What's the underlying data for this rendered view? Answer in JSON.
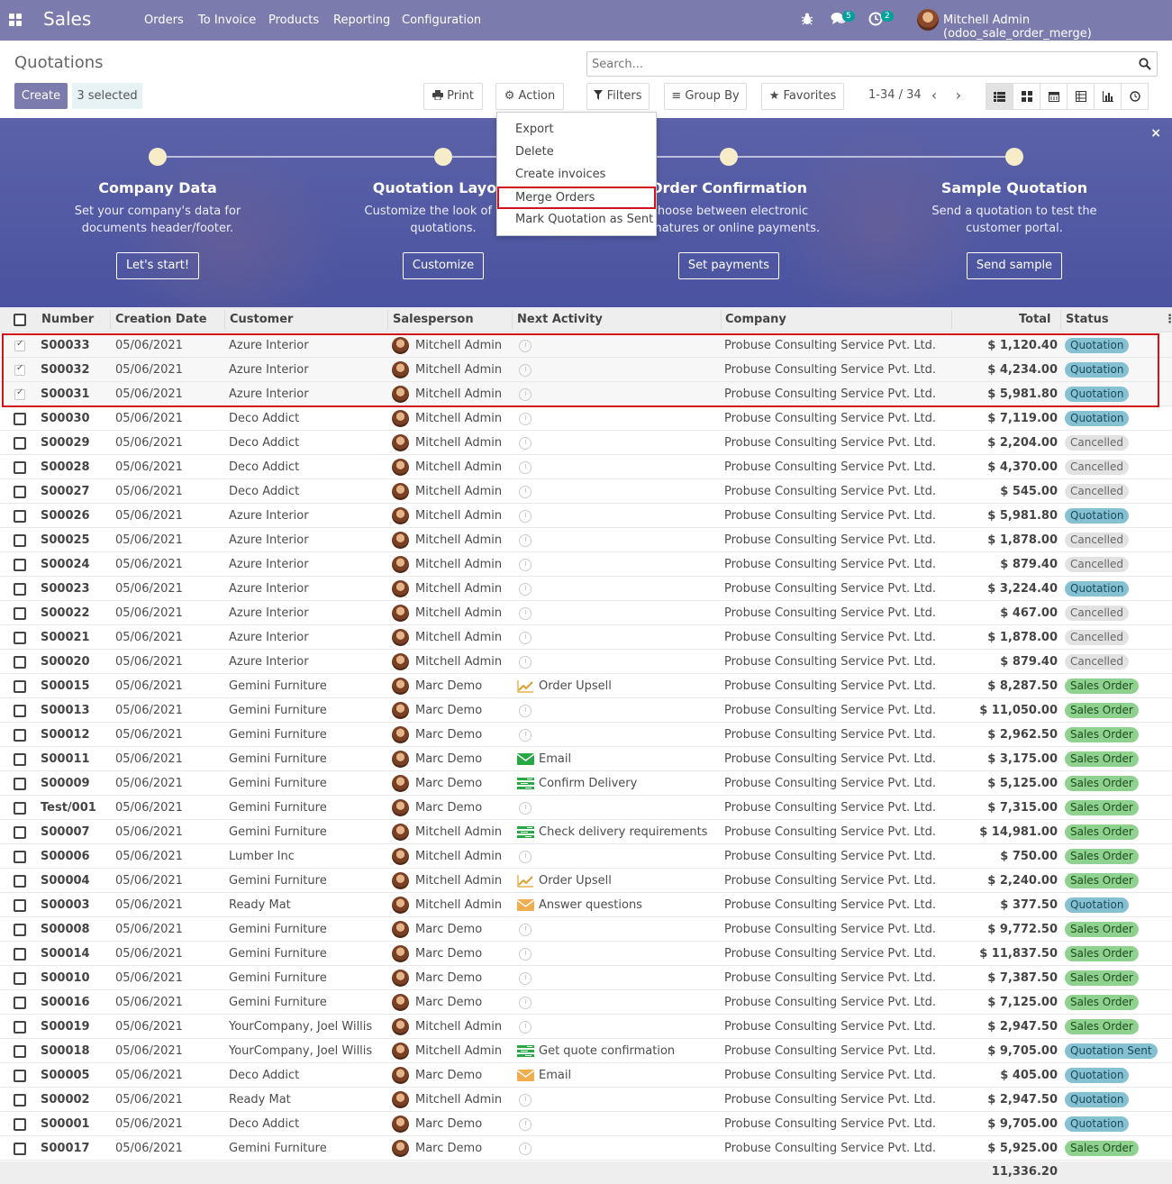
{
  "navbar": {
    "app_title": "Sales",
    "menu": [
      "Orders",
      "To Invoice",
      "Products",
      "Reporting",
      "Configuration"
    ],
    "messages_count": "5",
    "activities_count": "2",
    "user": "Mitchell Admin (odoo_sale_order_merge)"
  },
  "control": {
    "breadcrumb": "Quotations",
    "create": "Create",
    "selected": "3 selected",
    "print": "Print",
    "action": "Action",
    "search_placeholder": "Search...",
    "filters": "Filters",
    "group_by": "Group By",
    "favorites": "Favorites",
    "pager": "1-34 / 34"
  },
  "action_menu": [
    "Export",
    "Delete",
    "Create invoices",
    "Merge Orders",
    "Mark Quotation as Sent"
  ],
  "banner": {
    "steps": [
      {
        "title": "Company Data",
        "desc1": "Set your company's data for",
        "desc2": "documents header/footer.",
        "button": "Let's start!"
      },
      {
        "title": "Quotation Layout",
        "desc1": "Customize the look of your",
        "desc2": "quotations.",
        "button": "Customize"
      },
      {
        "title": "Order Confirmation",
        "desc1": "Choose between electronic",
        "desc2": "signatures or online payments.",
        "button": "Set payments"
      },
      {
        "title": "Sample Quotation",
        "desc1": "Send a quotation to test the",
        "desc2": "customer portal.",
        "button": "Send sample"
      }
    ],
    "close": "×"
  },
  "columns": [
    "Number",
    "Creation Date",
    "Customer",
    "Salesperson",
    "Next Activity",
    "Company",
    "Total",
    "Status"
  ],
  "rows": [
    {
      "num": "S00033",
      "date": "05/06/2021",
      "cust": "Azure Interior",
      "sp": "Mitchell Admin",
      "act": "",
      "actIcon": "",
      "comp": "Probuse Consulting Service Pvt. Ltd.",
      "total": "$ 1,120.40",
      "status": "Quotation",
      "st": "q",
      "sel": true
    },
    {
      "num": "S00032",
      "date": "05/06/2021",
      "cust": "Azure Interior",
      "sp": "Mitchell Admin",
      "act": "",
      "actIcon": "",
      "comp": "Probuse Consulting Service Pvt. Ltd.",
      "total": "$ 4,234.00",
      "status": "Quotation",
      "st": "q",
      "sel": true
    },
    {
      "num": "S00031",
      "date": "05/06/2021",
      "cust": "Azure Interior",
      "sp": "Mitchell Admin",
      "act": "",
      "actIcon": "",
      "comp": "Probuse Consulting Service Pvt. Ltd.",
      "total": "$ 5,981.80",
      "status": "Quotation",
      "st": "q",
      "sel": true
    },
    {
      "num": "S00030",
      "date": "05/06/2021",
      "cust": "Deco Addict",
      "sp": "Mitchell Admin",
      "act": "",
      "actIcon": "",
      "comp": "Probuse Consulting Service Pvt. Ltd.",
      "total": "$ 7,119.00",
      "status": "Quotation",
      "st": "q",
      "sel": false
    },
    {
      "num": "S00029",
      "date": "05/06/2021",
      "cust": "Deco Addict",
      "sp": "Mitchell Admin",
      "act": "",
      "actIcon": "",
      "comp": "Probuse Consulting Service Pvt. Ltd.",
      "total": "$ 2,204.00",
      "status": "Cancelled",
      "st": "c",
      "sel": false
    },
    {
      "num": "S00028",
      "date": "05/06/2021",
      "cust": "Deco Addict",
      "sp": "Mitchell Admin",
      "act": "",
      "actIcon": "",
      "comp": "Probuse Consulting Service Pvt. Ltd.",
      "total": "$ 4,370.00",
      "status": "Cancelled",
      "st": "c",
      "sel": false
    },
    {
      "num": "S00027",
      "date": "05/06/2021",
      "cust": "Deco Addict",
      "sp": "Mitchell Admin",
      "act": "",
      "actIcon": "",
      "comp": "Probuse Consulting Service Pvt. Ltd.",
      "total": "$ 545.00",
      "status": "Cancelled",
      "st": "c",
      "sel": false
    },
    {
      "num": "S00026",
      "date": "05/06/2021",
      "cust": "Azure Interior",
      "sp": "Mitchell Admin",
      "act": "",
      "actIcon": "",
      "comp": "Probuse Consulting Service Pvt. Ltd.",
      "total": "$ 5,981.80",
      "status": "Quotation",
      "st": "q",
      "sel": false
    },
    {
      "num": "S00025",
      "date": "05/06/2021",
      "cust": "Azure Interior",
      "sp": "Mitchell Admin",
      "act": "",
      "actIcon": "",
      "comp": "Probuse Consulting Service Pvt. Ltd.",
      "total": "$ 1,878.00",
      "status": "Cancelled",
      "st": "c",
      "sel": false
    },
    {
      "num": "S00024",
      "date": "05/06/2021",
      "cust": "Azure Interior",
      "sp": "Mitchell Admin",
      "act": "",
      "actIcon": "",
      "comp": "Probuse Consulting Service Pvt. Ltd.",
      "total": "$ 879.40",
      "status": "Cancelled",
      "st": "c",
      "sel": false
    },
    {
      "num": "S00023",
      "date": "05/06/2021",
      "cust": "Azure Interior",
      "sp": "Mitchell Admin",
      "act": "",
      "actIcon": "",
      "comp": "Probuse Consulting Service Pvt. Ltd.",
      "total": "$ 3,224.40",
      "status": "Quotation",
      "st": "q",
      "sel": false
    },
    {
      "num": "S00022",
      "date": "05/06/2021",
      "cust": "Azure Interior",
      "sp": "Mitchell Admin",
      "act": "",
      "actIcon": "",
      "comp": "Probuse Consulting Service Pvt. Ltd.",
      "total": "$ 467.00",
      "status": "Cancelled",
      "st": "c",
      "sel": false
    },
    {
      "num": "S00021",
      "date": "05/06/2021",
      "cust": "Azure Interior",
      "sp": "Mitchell Admin",
      "act": "",
      "actIcon": "",
      "comp": "Probuse Consulting Service Pvt. Ltd.",
      "total": "$ 1,878.00",
      "status": "Cancelled",
      "st": "c",
      "sel": false
    },
    {
      "num": "S00020",
      "date": "05/06/2021",
      "cust": "Azure Interior",
      "sp": "Mitchell Admin",
      "act": "",
      "actIcon": "",
      "comp": "Probuse Consulting Service Pvt. Ltd.",
      "total": "$ 879.40",
      "status": "Cancelled",
      "st": "c",
      "sel": false
    },
    {
      "num": "S00015",
      "date": "05/06/2021",
      "cust": "Gemini Furniture",
      "sp": "Marc Demo",
      "act": "Order Upsell",
      "actIcon": "upsell",
      "comp": "Probuse Consulting Service Pvt. Ltd.",
      "total": "$ 8,287.50",
      "status": "Sales Order",
      "st": "s",
      "sel": false
    },
    {
      "num": "S00013",
      "date": "05/06/2021",
      "cust": "Gemini Furniture",
      "sp": "Marc Demo",
      "act": "",
      "actIcon": "",
      "comp": "Probuse Consulting Service Pvt. Ltd.",
      "total": "$ 11,050.00",
      "status": "Sales Order",
      "st": "s",
      "sel": false
    },
    {
      "num": "S00012",
      "date": "05/06/2021",
      "cust": "Gemini Furniture",
      "sp": "Marc Demo",
      "act": "",
      "actIcon": "",
      "comp": "Probuse Consulting Service Pvt. Ltd.",
      "total": "$ 2,962.50",
      "status": "Sales Order",
      "st": "s",
      "sel": false
    },
    {
      "num": "S00011",
      "date": "05/06/2021",
      "cust": "Gemini Furniture",
      "sp": "Marc Demo",
      "act": "Email",
      "actIcon": "email-green",
      "comp": "Probuse Consulting Service Pvt. Ltd.",
      "total": "$ 3,175.00",
      "status": "Sales Order",
      "st": "s",
      "sel": false
    },
    {
      "num": "S00009",
      "date": "05/06/2021",
      "cust": "Gemini Furniture",
      "sp": "Marc Demo",
      "act": "Confirm Delivery",
      "actIcon": "tasks",
      "comp": "Probuse Consulting Service Pvt. Ltd.",
      "total": "$ 5,125.00",
      "status": "Sales Order",
      "st": "s",
      "sel": false
    },
    {
      "num": "Test/001",
      "date": "05/06/2021",
      "cust": "Gemini Furniture",
      "sp": "Marc Demo",
      "act": "",
      "actIcon": "",
      "comp": "Probuse Consulting Service Pvt. Ltd.",
      "total": "$ 7,315.00",
      "status": "Sales Order",
      "st": "s",
      "sel": false
    },
    {
      "num": "S00007",
      "date": "05/06/2021",
      "cust": "Gemini Furniture",
      "sp": "Mitchell Admin",
      "act": "Check delivery requirements",
      "actIcon": "tasks",
      "comp": "Probuse Consulting Service Pvt. Ltd.",
      "total": "$ 14,981.00",
      "status": "Sales Order",
      "st": "s",
      "sel": false
    },
    {
      "num": "S00006",
      "date": "05/06/2021",
      "cust": "Lumber Inc",
      "sp": "Mitchell Admin",
      "act": "",
      "actIcon": "",
      "comp": "Probuse Consulting Service Pvt. Ltd.",
      "total": "$ 750.00",
      "status": "Sales Order",
      "st": "s",
      "sel": false
    },
    {
      "num": "S00004",
      "date": "05/06/2021",
      "cust": "Gemini Furniture",
      "sp": "Mitchell Admin",
      "act": "Order Upsell",
      "actIcon": "upsell",
      "comp": "Probuse Consulting Service Pvt. Ltd.",
      "total": "$ 2,240.00",
      "status": "Sales Order",
      "st": "s",
      "sel": false
    },
    {
      "num": "S00003",
      "date": "05/06/2021",
      "cust": "Ready Mat",
      "sp": "Mitchell Admin",
      "act": "Answer questions",
      "actIcon": "email-orange",
      "comp": "Probuse Consulting Service Pvt. Ltd.",
      "total": "$ 377.50",
      "status": "Quotation",
      "st": "q",
      "sel": false
    },
    {
      "num": "S00008",
      "date": "05/06/2021",
      "cust": "Gemini Furniture",
      "sp": "Marc Demo",
      "act": "",
      "actIcon": "",
      "comp": "Probuse Consulting Service Pvt. Ltd.",
      "total": "$ 9,772.50",
      "status": "Sales Order",
      "st": "s",
      "sel": false
    },
    {
      "num": "S00014",
      "date": "05/06/2021",
      "cust": "Gemini Furniture",
      "sp": "Marc Demo",
      "act": "",
      "actIcon": "",
      "comp": "Probuse Consulting Service Pvt. Ltd.",
      "total": "$ 11,837.50",
      "status": "Sales Order",
      "st": "s",
      "sel": false
    },
    {
      "num": "S00010",
      "date": "05/06/2021",
      "cust": "Gemini Furniture",
      "sp": "Marc Demo",
      "act": "",
      "actIcon": "",
      "comp": "Probuse Consulting Service Pvt. Ltd.",
      "total": "$ 7,387.50",
      "status": "Sales Order",
      "st": "s",
      "sel": false
    },
    {
      "num": "S00016",
      "date": "05/06/2021",
      "cust": "Gemini Furniture",
      "sp": "Marc Demo",
      "act": "",
      "actIcon": "",
      "comp": "Probuse Consulting Service Pvt. Ltd.",
      "total": "$ 7,125.00",
      "status": "Sales Order",
      "st": "s",
      "sel": false
    },
    {
      "num": "S00019",
      "date": "05/06/2021",
      "cust": "YourCompany, Joel Willis",
      "sp": "Mitchell Admin",
      "act": "",
      "actIcon": "",
      "comp": "Probuse Consulting Service Pvt. Ltd.",
      "total": "$ 2,947.50",
      "status": "Sales Order",
      "st": "s",
      "sel": false
    },
    {
      "num": "S00018",
      "date": "05/06/2021",
      "cust": "YourCompany, Joel Willis",
      "sp": "Mitchell Admin",
      "act": "Get quote confirmation",
      "actIcon": "tasks",
      "comp": "Probuse Consulting Service Pvt. Ltd.",
      "total": "$ 9,705.00",
      "status": "Quotation Sent",
      "st": "q",
      "sel": false
    },
    {
      "num": "S00005",
      "date": "05/06/2021",
      "cust": "Deco Addict",
      "sp": "Marc Demo",
      "act": "Email",
      "actIcon": "email-orange",
      "comp": "Probuse Consulting Service Pvt. Ltd.",
      "total": "$ 405.00",
      "status": "Quotation",
      "st": "q",
      "sel": false
    },
    {
      "num": "S00002",
      "date": "05/06/2021",
      "cust": "Ready Mat",
      "sp": "Mitchell Admin",
      "act": "",
      "actIcon": "",
      "comp": "Probuse Consulting Service Pvt. Ltd.",
      "total": "$ 2,947.50",
      "status": "Quotation",
      "st": "q",
      "sel": false
    },
    {
      "num": "S00001",
      "date": "05/06/2021",
      "cust": "Deco Addict",
      "sp": "Marc Demo",
      "act": "",
      "actIcon": "",
      "comp": "Probuse Consulting Service Pvt. Ltd.",
      "total": "$ 9,705.00",
      "status": "Quotation",
      "st": "q",
      "sel": false
    },
    {
      "num": "S00017",
      "date": "05/06/2021",
      "cust": "Gemini Furniture",
      "sp": "Marc Demo",
      "act": "",
      "actIcon": "",
      "comp": "Probuse Consulting Service Pvt. Ltd.",
      "total": "$ 5,925.00",
      "status": "Sales Order",
      "st": "s",
      "sel": false
    }
  ],
  "grand_total": "11,336.20",
  "colors": {
    "brand": "#7c7bad",
    "highlight": "#d0121b",
    "quotation": "#85c1d3",
    "sales_order": "#8fd18f",
    "cancelled": "#e2e2e2"
  }
}
